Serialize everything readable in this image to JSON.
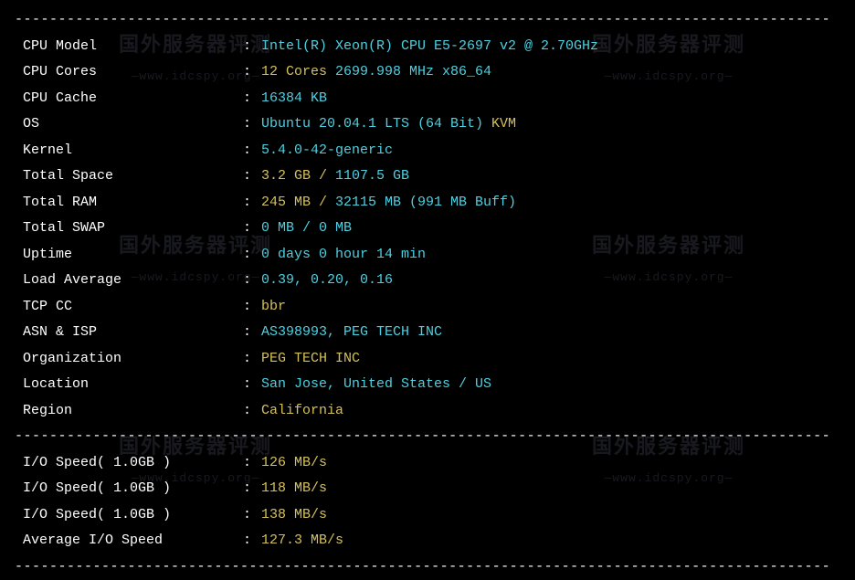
{
  "divider": "----------------------------------------------------------------------------------------------",
  "rows": [
    {
      "label": " CPU Model             ",
      "parts": [
        {
          "cls": "val-cyan",
          "text": "Intel(R) Xeon(R) CPU E5-2697 v2 @ 2.70GHz"
        }
      ]
    },
    {
      "label": " CPU Cores             ",
      "parts": [
        {
          "cls": "val-yellow",
          "text": "12 Cores "
        },
        {
          "cls": "val-cyan",
          "text": "2699.998 MHz x86_64"
        }
      ]
    },
    {
      "label": " CPU Cache             ",
      "parts": [
        {
          "cls": "val-cyan",
          "text": "16384 KB"
        }
      ]
    },
    {
      "label": " OS                    ",
      "parts": [
        {
          "cls": "val-cyan",
          "text": "Ubuntu 20.04.1 LTS (64 Bit) "
        },
        {
          "cls": "val-yellow",
          "text": "KVM"
        }
      ]
    },
    {
      "label": " Kernel                ",
      "parts": [
        {
          "cls": "val-cyan",
          "text": "5.4.0-42-generic"
        }
      ]
    },
    {
      "label": " Total Space           ",
      "parts": [
        {
          "cls": "val-yellow",
          "text": "3.2 GB / "
        },
        {
          "cls": "val-cyan",
          "text": "1107.5 GB"
        }
      ]
    },
    {
      "label": " Total RAM             ",
      "parts": [
        {
          "cls": "val-yellow",
          "text": "245 MB / "
        },
        {
          "cls": "val-cyan",
          "text": "32115 MB "
        },
        {
          "cls": "val-cyan",
          "text": "(991 MB Buff)"
        }
      ]
    },
    {
      "label": " Total SWAP            ",
      "parts": [
        {
          "cls": "val-cyan",
          "text": "0 MB / 0 MB"
        }
      ]
    },
    {
      "label": " Uptime                ",
      "parts": [
        {
          "cls": "val-cyan",
          "text": "0 days 0 hour 14 min"
        }
      ]
    },
    {
      "label": " Load Average          ",
      "parts": [
        {
          "cls": "val-cyan",
          "text": "0.39, 0.20, 0.16"
        }
      ]
    },
    {
      "label": " TCP CC                ",
      "parts": [
        {
          "cls": "val-yellow",
          "text": "bbr"
        }
      ]
    },
    {
      "label": " ASN & ISP             ",
      "parts": [
        {
          "cls": "val-cyan",
          "text": "AS398993, PEG TECH INC"
        }
      ]
    },
    {
      "label": " Organization          ",
      "parts": [
        {
          "cls": "val-yellow",
          "text": "PEG TECH INC"
        }
      ]
    },
    {
      "label": " Location              ",
      "parts": [
        {
          "cls": "val-cyan",
          "text": "San Jose, United States / US"
        }
      ]
    },
    {
      "label": " Region                ",
      "parts": [
        {
          "cls": "val-yellow",
          "text": "California"
        }
      ]
    }
  ],
  "io_rows": [
    {
      "label": " I/O Speed( 1.0GB )    ",
      "parts": [
        {
          "cls": "val-yellow",
          "text": "126 MB/s"
        }
      ]
    },
    {
      "label": " I/O Speed( 1.0GB )    ",
      "parts": [
        {
          "cls": "val-yellow",
          "text": "118 MB/s"
        }
      ]
    },
    {
      "label": " I/O Speed( 1.0GB )    ",
      "parts": [
        {
          "cls": "val-yellow",
          "text": "138 MB/s"
        }
      ]
    },
    {
      "label": " Average I/O Speed     ",
      "parts": [
        {
          "cls": "val-yellow",
          "text": "127.3 MB/s"
        }
      ]
    }
  ],
  "colon": ": ",
  "watermark": {
    "top": "国外服务器评测",
    "bot": "—www.idcspy.org—"
  }
}
